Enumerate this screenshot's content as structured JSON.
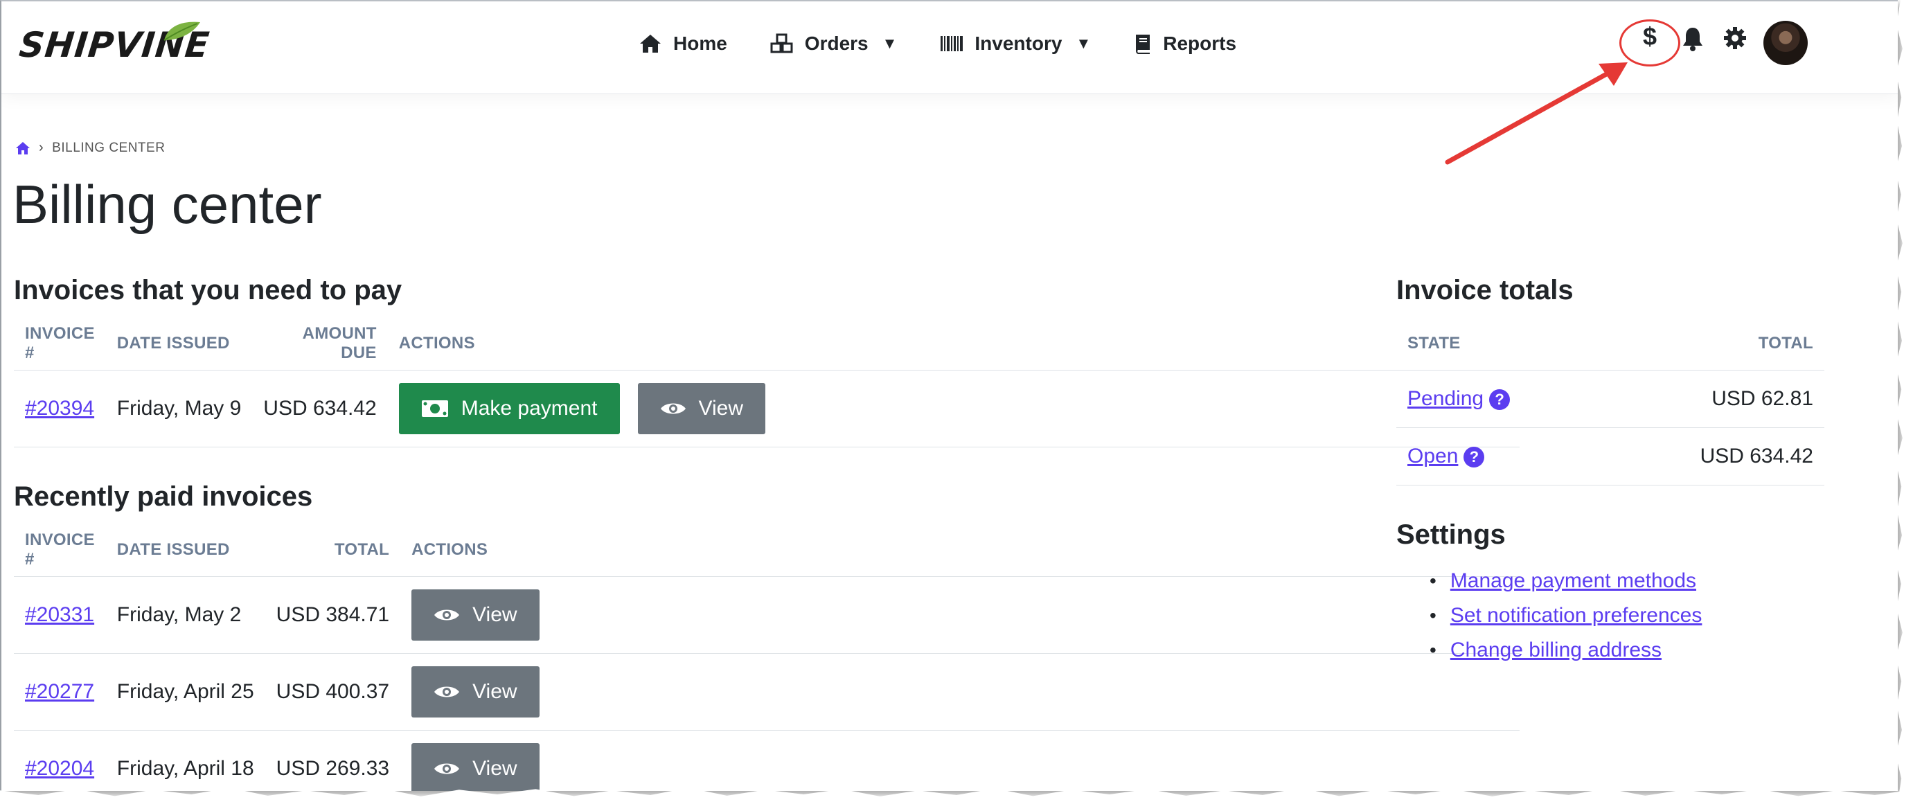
{
  "navbar": {
    "logo_text": "SHIPVINE",
    "links": [
      {
        "label": "Home",
        "icon": "home-icon"
      },
      {
        "label": "Orders",
        "icon": "boxes-icon",
        "dropdown": true
      },
      {
        "label": "Inventory",
        "icon": "barcode-icon",
        "dropdown": true
      },
      {
        "label": "Reports",
        "icon": "book-icon"
      }
    ],
    "billing_symbol": "$",
    "icons": [
      "dollar-icon",
      "bell-icon",
      "gear-icon",
      "avatar"
    ]
  },
  "breadcrumb": {
    "current": "BILLING CENTER"
  },
  "page_title": "Billing center",
  "unpaid": {
    "heading": "Invoices that you need to pay",
    "columns": [
      "INVOICE #",
      "DATE ISSUED",
      "AMOUNT DUE",
      "ACTIONS"
    ],
    "rows": [
      {
        "invoice": "#20394",
        "date": "Friday, May 9",
        "amount": "USD 634.42",
        "pay_label": "Make payment",
        "view_label": "View"
      }
    ]
  },
  "paid": {
    "heading": "Recently paid invoices",
    "columns": [
      "INVOICE #",
      "DATE ISSUED",
      "TOTAL",
      "ACTIONS"
    ],
    "rows": [
      {
        "invoice": "#20331",
        "date": "Friday, May 2",
        "total": "USD 384.71",
        "view_label": "View"
      },
      {
        "invoice": "#20277",
        "date": "Friday, April 25",
        "total": "USD 400.37",
        "view_label": "View"
      },
      {
        "invoice": "#20204",
        "date": "Friday, April 18",
        "total": "USD 269.33",
        "view_label": "View"
      }
    ]
  },
  "totals": {
    "heading": "Invoice totals",
    "columns": [
      "STATE",
      "TOTAL"
    ],
    "rows": [
      {
        "state": "Pending",
        "help": "?",
        "total": "USD 62.81"
      },
      {
        "state": "Open",
        "help": "?",
        "total": "USD 634.42"
      }
    ]
  },
  "settings": {
    "heading": "Settings",
    "links": [
      "Manage payment methods",
      "Set notification preferences",
      "Change billing address"
    ]
  },
  "colors": {
    "accent": "#5b3df0",
    "success": "#1f8a4c",
    "secondary": "#6c757d",
    "annotation": "#e53935"
  }
}
